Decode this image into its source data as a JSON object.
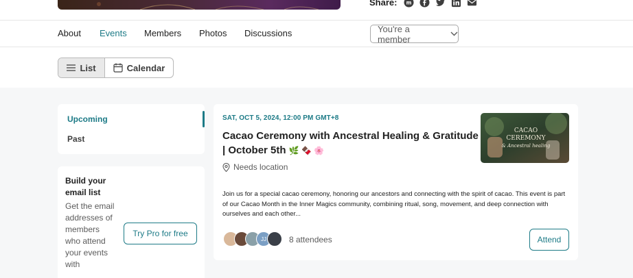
{
  "share": {
    "label": "Share:",
    "icons": [
      "meetup-icon",
      "facebook-icon",
      "twitter-icon",
      "linkedin-icon",
      "email-icon"
    ]
  },
  "nav": {
    "items": [
      {
        "label": "About",
        "active": false
      },
      {
        "label": "Events",
        "active": true
      },
      {
        "label": "Members",
        "active": false
      },
      {
        "label": "Photos",
        "active": false
      },
      {
        "label": "Discussions",
        "active": false
      }
    ],
    "member_button": "You're a member"
  },
  "view_toggle": {
    "list_label": "List",
    "calendar_label": "Calendar",
    "selected": "List"
  },
  "sidebar": {
    "tabs": [
      {
        "label": "Upcoming",
        "active": true
      },
      {
        "label": "Past",
        "active": false
      }
    ],
    "email_card": {
      "title": "Build your email list",
      "text": "Get the email addresses of members who attend your events with",
      "button": "Try Pro for free"
    }
  },
  "event": {
    "date": "SAT, OCT 5, 2024, 12:00 PM GMT+8",
    "title": "Cacao Ceremony with Ancestral Healing & Gratitude | October 5th",
    "title_emoji": "🌿 🍫 🌸",
    "location": "Needs location",
    "image_text": [
      "CACAO",
      "CEREMONY",
      "& Ancestral healing"
    ],
    "description": "Join us for a special cacao ceremony, honoring our ancestors and connecting with the spirit of cacao. This event is part of our Cacao Month in the Inner Magics community, combining ritual, song, movement, and deep connection with ourselves and each other...",
    "attendees_label": "8 attendees",
    "avatar_initials": "JJ",
    "attend_button": "Attend"
  },
  "colors": {
    "accent": "#1c7a86",
    "page_bg": "#f6f7f8"
  }
}
